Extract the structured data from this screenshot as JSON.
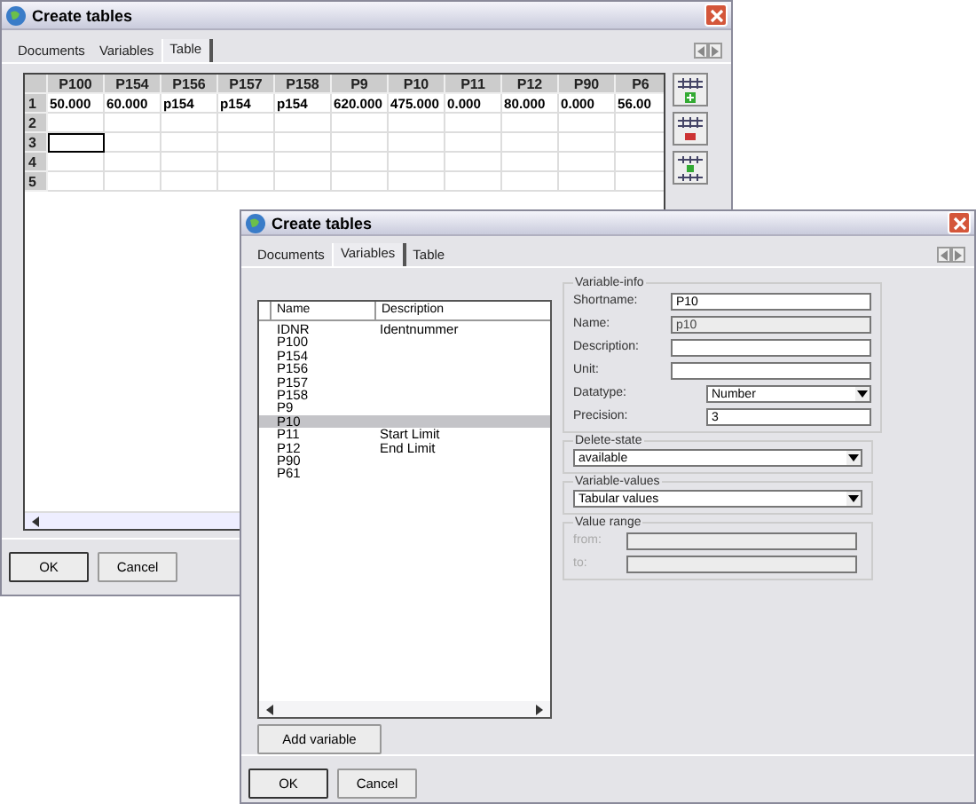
{
  "back_window": {
    "title": "Create tables",
    "tabs": [
      {
        "label": "Documents",
        "selected": false
      },
      {
        "label": "Variables",
        "selected": false
      },
      {
        "label": "Table",
        "selected": true
      }
    ],
    "table": {
      "columns": [
        "P100",
        "P154",
        "P156",
        "P157",
        "P158",
        "P9",
        "P10",
        "P11",
        "P12",
        "P90",
        "P6"
      ],
      "rows": [
        {
          "number": "1",
          "focused": false,
          "cells": [
            "50.000",
            "60.000",
            "p154",
            "p154",
            "p154",
            "620.000",
            "475.000",
            "0.000",
            "80.000",
            "0.000",
            "56.00"
          ]
        },
        {
          "number": "2",
          "focused": false,
          "cells": []
        },
        {
          "number": "3",
          "focused": true,
          "cells": []
        },
        {
          "number": "4",
          "focused": false,
          "cells": []
        },
        {
          "number": "5",
          "focused": false,
          "cells": []
        }
      ]
    },
    "buttons": [
      "OK",
      "Cancel"
    ]
  },
  "front_window": {
    "title": "Create tables",
    "tabs": [
      {
        "label": "Documents",
        "selected": false
      },
      {
        "label": "Variables",
        "selected": true
      },
      {
        "label": "Table",
        "selected": false
      }
    ],
    "variables": {
      "columns": [
        "Name",
        "Description"
      ],
      "items": [
        {
          "name": "IDNR",
          "description": "Identnummer",
          "selected": false
        },
        {
          "name": "P100",
          "selected": false
        },
        {
          "name": "P154",
          "selected": false
        },
        {
          "name": "P156",
          "selected": false
        },
        {
          "name": "P157",
          "selected": false
        },
        {
          "name": "P158",
          "selected": false
        },
        {
          "name": "P9",
          "selected": false
        },
        {
          "name": "P10",
          "selected": true
        },
        {
          "name": "P11",
          "description": "Start Limit",
          "selected": false
        },
        {
          "name": "P12",
          "description": "End Limit",
          "selected": false
        },
        {
          "name": "P90",
          "selected": false
        },
        {
          "name": "P61",
          "selected": false
        }
      ]
    },
    "add_button": "Add variable",
    "variable_info": {
      "title": "Variable-info",
      "fields": [
        {
          "label": "Shortname:",
          "value": "P10",
          "kind": "text"
        },
        {
          "label": "Name:",
          "value": "p10",
          "kind": "readonly"
        },
        {
          "label": "Description:",
          "kind": "text"
        },
        {
          "label": "Unit:",
          "kind": "text"
        },
        {
          "label": "Datatype:",
          "value": "Number",
          "kind": "select"
        },
        {
          "label": "Precision:",
          "value": "3",
          "kind": "short"
        }
      ]
    },
    "delete_state": {
      "title": "Delete-state",
      "value": "available"
    },
    "variable_values": {
      "title": "Variable-values",
      "value": "Tabular values"
    },
    "value_range": {
      "title": "Value range",
      "disabled": true,
      "fields": [
        {
          "label": "from:"
        },
        {
          "label": "to:"
        }
      ]
    },
    "buttons": [
      "OK",
      "Cancel"
    ]
  }
}
